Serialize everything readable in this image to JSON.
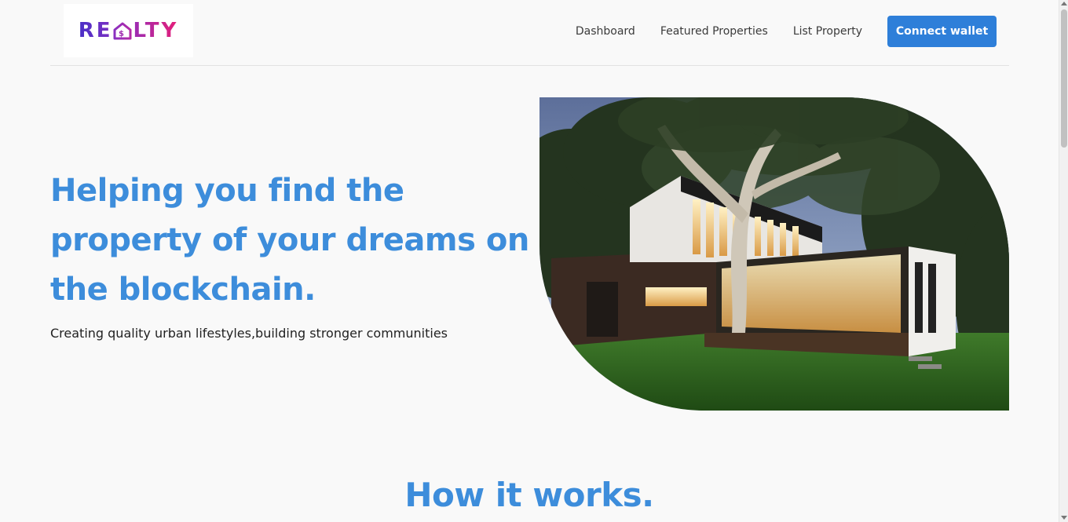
{
  "brand": {
    "logo_text_left": "RE",
    "logo_text_right": "LTY",
    "logo_icon": "house-dollar-icon",
    "gradient": [
      "#4a2fc7",
      "#e61e78"
    ]
  },
  "nav": {
    "items": [
      {
        "label": "Dashboard"
      },
      {
        "label": "Featured Properties"
      },
      {
        "label": "List Property"
      }
    ],
    "cta_label": "Connect wallet"
  },
  "hero": {
    "title": "Helping you find the property of your dreams on the blockchain.",
    "subtitle": "Creating quality urban lifestyles,building stronger communities",
    "image": "modern-house-photo"
  },
  "how_it_works": {
    "title": "How it works."
  },
  "colors": {
    "accent": "#3d8ddb",
    "button": "#2e7fd9",
    "background": "#f9f9f9"
  }
}
